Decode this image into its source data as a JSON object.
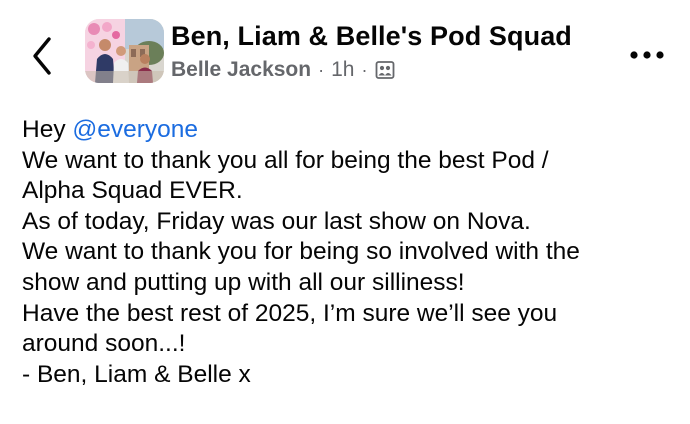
{
  "header": {
    "group_title": "Ben, Liam & Belle's Pod Squad",
    "author": "Belle Jackson",
    "separator": "·",
    "time": "1h",
    "separator2": "·",
    "audience_icon": "group-audience-icon",
    "back_icon": "chevron-left-icon",
    "more_icon": "more-options-icon"
  },
  "post": {
    "greeting_word": "Hey",
    "mention": "@everyone",
    "lines": [
      "We want to thank you all for being the best Pod /",
      "Alpha Squad EVER.",
      "As of today, Friday was our last show on Nova.",
      "We want to thank you for being so involved with the",
      "show and putting up with all our silliness!",
      "Have the best rest of 2025, I’m sure we’ll see you",
      "around soon...!",
      "- Ben, Liam & Belle x"
    ]
  },
  "colors": {
    "mention": "#1b6ce0",
    "meta_text": "#65676b",
    "primary_text": "#050505"
  }
}
